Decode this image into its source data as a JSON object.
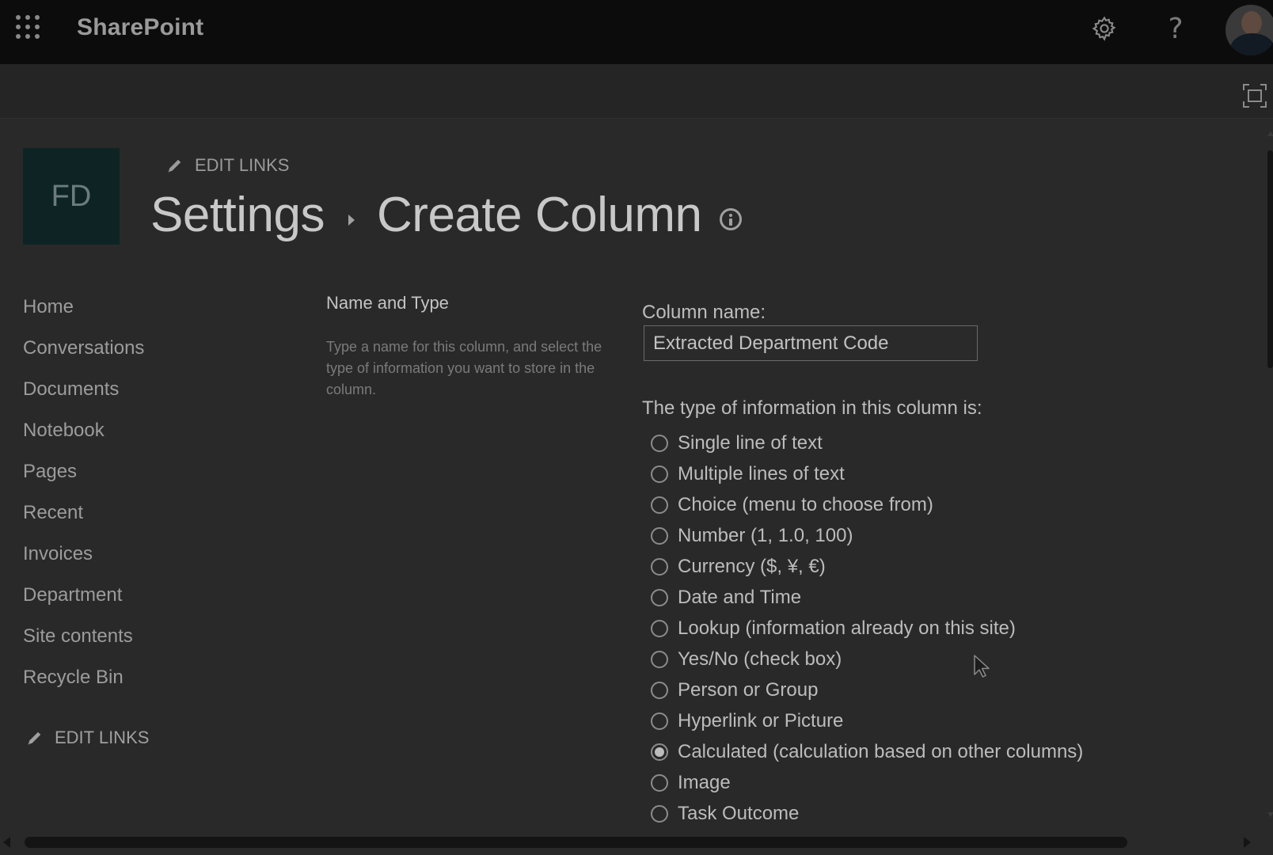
{
  "suite_bar": {
    "brand": "SharePoint",
    "help_glyph": "?",
    "icons": [
      "app-launcher-icon",
      "gear-icon",
      "help-icon",
      "avatar"
    ]
  },
  "site": {
    "logo_text": "FD",
    "edit_links_label": "EDIT LINKS"
  },
  "breadcrumb": {
    "parent": "Settings",
    "current": "Create Column"
  },
  "nav": {
    "items": [
      {
        "label": "Home"
      },
      {
        "label": "Conversations"
      },
      {
        "label": "Documents"
      },
      {
        "label": "Notebook"
      },
      {
        "label": "Pages"
      },
      {
        "label": "Recent"
      },
      {
        "label": "Invoices"
      },
      {
        "label": "Department"
      },
      {
        "label": "Site contents"
      },
      {
        "label": "Recycle Bin"
      }
    ],
    "edit_links_label": "EDIT LINKS"
  },
  "section": {
    "title": "Name and Type",
    "description": "Type a name for this column, and select the type of information you want to store in the column."
  },
  "form": {
    "column_name_label": "Column name:",
    "column_name_value": "Extracted Department Code",
    "type_label": "The type of information in this column is:",
    "types": [
      {
        "label": "Single line of text",
        "checked": false
      },
      {
        "label": "Multiple lines of text",
        "checked": false
      },
      {
        "label": "Choice (menu to choose from)",
        "checked": false
      },
      {
        "label": "Number (1, 1.0, 100)",
        "checked": false
      },
      {
        "label": "Currency ($, ¥, €)",
        "checked": false
      },
      {
        "label": "Date and Time",
        "checked": false
      },
      {
        "label": "Lookup (information already on this site)",
        "checked": false
      },
      {
        "label": "Yes/No (check box)",
        "checked": false
      },
      {
        "label": "Person or Group",
        "checked": false
      },
      {
        "label": "Hyperlink or Picture",
        "checked": false
      },
      {
        "label": "Calculated (calculation based on other columns)",
        "checked": true
      },
      {
        "label": "Image",
        "checked": false
      },
      {
        "label": "Task Outcome",
        "checked": false
      }
    ]
  },
  "colors": {
    "suite_bar_bg": "#0c0c0c",
    "page_bg": "#292929",
    "logo_bg": "#0e2424"
  }
}
